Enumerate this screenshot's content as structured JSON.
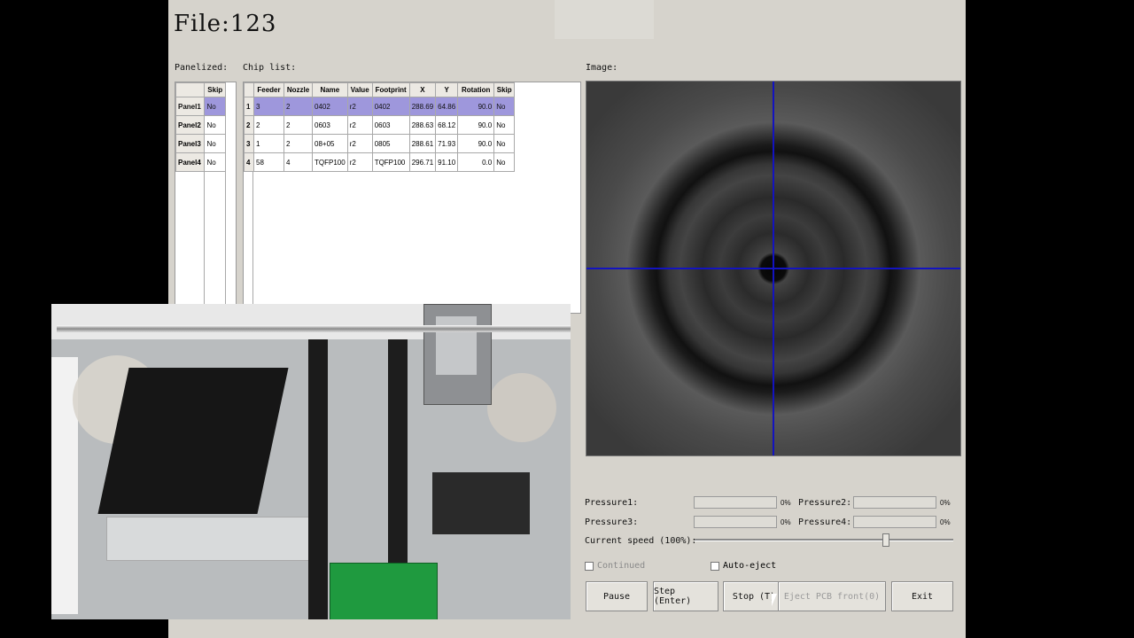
{
  "header": {
    "file_title": "File:123"
  },
  "labels": {
    "panelized": "Panelized:",
    "chip_list": "Chip list:",
    "image": "Image:"
  },
  "panels": {
    "columns": [
      "",
      "Skip"
    ],
    "rows": [
      {
        "name": "Panel1",
        "skip": "No"
      },
      {
        "name": "Panel2",
        "skip": "No"
      },
      {
        "name": "Panel3",
        "skip": "No"
      },
      {
        "name": "Panel4",
        "skip": "No"
      }
    ]
  },
  "chips": {
    "columns": [
      "",
      "Feeder",
      "Nozzle",
      "Name",
      "Value",
      "Footprint",
      "X",
      "Y",
      "Rotation",
      "Skip"
    ],
    "rows": [
      {
        "idx": "1",
        "feeder": "3",
        "nozzle": "2",
        "name": "0402",
        "value": "r2",
        "footprint": "0402",
        "x": "288.69",
        "y": "64.86",
        "rotation": "90.0",
        "skip": "No"
      },
      {
        "idx": "2",
        "feeder": "2",
        "nozzle": "2",
        "name": "0603",
        "value": "r2",
        "footprint": "0603",
        "x": "288.63",
        "y": "68.12",
        "rotation": "90.0",
        "skip": "No"
      },
      {
        "idx": "3",
        "feeder": "1",
        "nozzle": "2",
        "name": "08+05",
        "value": "r2",
        "footprint": "0805",
        "x": "288.61",
        "y": "71.93",
        "rotation": "90.0",
        "skip": "No"
      },
      {
        "idx": "4",
        "feeder": "58",
        "nozzle": "4",
        "name": "TQFP100",
        "value": "r2",
        "footprint": "TQFP100",
        "x": "296.71",
        "y": "91.10",
        "rotation": "0.0",
        "skip": "No"
      }
    ]
  },
  "pressure": {
    "p1_label": "Pressure1:",
    "p1_value": "0%",
    "p2_label": "Pressure2:",
    "p2_value": "0%",
    "p3_label": "Pressure3:",
    "p3_value": "0%",
    "p4_label": "Pressure4:",
    "p4_value": "0%"
  },
  "speed": {
    "label": "Current speed (100%):",
    "level": 0.74
  },
  "options": {
    "continued": "Continued",
    "auto_eject": "Auto-eject"
  },
  "buttons": {
    "pause": "Pause",
    "step": "Step (Enter)",
    "stop": "Stop (T)",
    "eject": "Eject PCB front(0)",
    "exit": "Exit"
  },
  "colors": {
    "selected_row": "#9e97dc",
    "crosshair": "#1313c0",
    "window_bg": "#d6d3cc"
  }
}
